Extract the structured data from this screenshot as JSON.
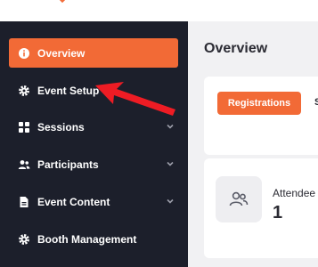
{
  "sidebar": {
    "items": [
      {
        "label": "Overview",
        "icon": "info-icon",
        "active": true,
        "has_chevron": false
      },
      {
        "label": "Event Setup",
        "icon": "gear-icon",
        "active": false,
        "has_chevron": false
      },
      {
        "label": "Sessions",
        "icon": "grid-icon",
        "active": false,
        "has_chevron": true
      },
      {
        "label": "Participants",
        "icon": "users-icon",
        "active": false,
        "has_chevron": true
      },
      {
        "label": "Event Content",
        "icon": "document-icon",
        "active": false,
        "has_chevron": true
      },
      {
        "label": "Booth Management",
        "icon": "gear-icon",
        "active": false,
        "has_chevron": false
      }
    ]
  },
  "main": {
    "title": "Overview",
    "tabs": [
      "Registrations",
      "S"
    ],
    "stat": {
      "label": "Attendee",
      "value": "1",
      "icon": "people-icon"
    }
  },
  "colors": {
    "accent": "#f26a36",
    "sidebar_bg": "#1c1f2b",
    "annotation_arrow": "#ee1c24"
  }
}
